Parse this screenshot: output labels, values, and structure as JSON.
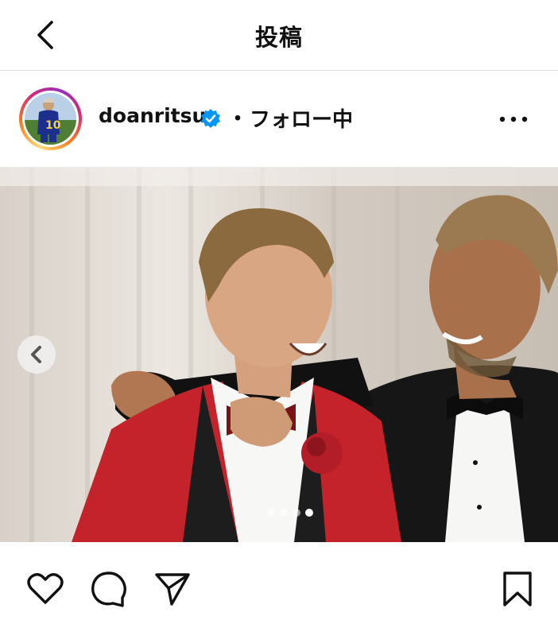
{
  "header": {
    "title": "投稿",
    "back_icon": "chevron-left-icon"
  },
  "post": {
    "username": "doanritsu",
    "verified": true,
    "separator": "・",
    "follow_status": "フォロー中",
    "more_icon": "more-horizontal-icon",
    "avatar_jersey_number": "10"
  },
  "carousel": {
    "total": 4,
    "active": 4,
    "prev_icon": "chevron-left-icon"
  },
  "actions": {
    "like_icon": "heart-icon",
    "comment_icon": "comment-icon",
    "share_icon": "send-icon",
    "save_icon": "bookmark-icon"
  },
  "colors": {
    "verified_blue": "#0095f6",
    "divider": "#dbdbdb",
    "jacket_red": "#c4232b"
  }
}
